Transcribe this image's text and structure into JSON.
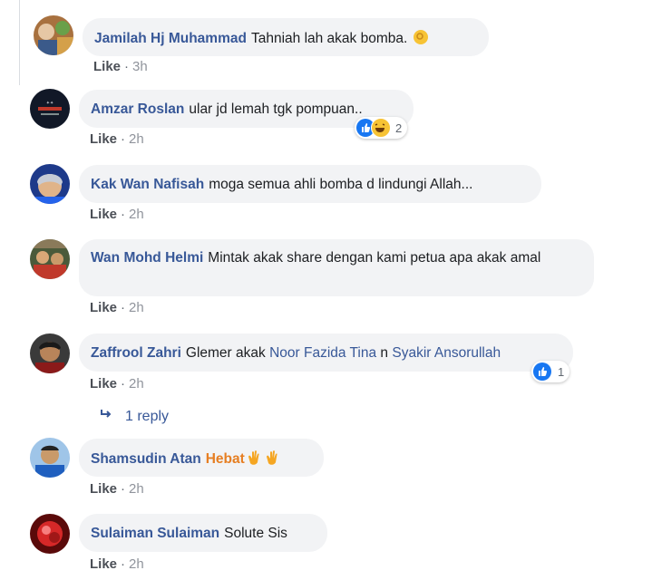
{
  "comments": [
    {
      "name": "Jamilah Hj Muhammad",
      "text": "Tahniah lah akak bomba.",
      "like": "Like",
      "time": "3h"
    },
    {
      "name": "Amzar Roslan",
      "text": "ular jd lemah tgk pompuan..",
      "like": "Like",
      "time": "2h",
      "reaction_count": "2"
    },
    {
      "name": "Kak Wan Nafisah",
      "text": "moga semua ahli bomba d lindungi Allah...",
      "like": "Like",
      "time": "2h"
    },
    {
      "name": "Wan Mohd Helmi",
      "text": "Mintak akak share dengan kami petua apa akak amal",
      "like": "Like",
      "time": "2h"
    },
    {
      "name": "Zaffrool Zahri",
      "text": "Glemer akak",
      "mention1": "Noor Fazida Tina",
      "conj": "n",
      "mention2": "Syakir Ansorullah",
      "like": "Like",
      "time": "2h",
      "reaction_count": "1"
    },
    {
      "name": "Shamsudin Atan",
      "text": "Hebat",
      "like": "Like",
      "time": "2h"
    },
    {
      "name": "Sulaiman Sulaiman",
      "text": "Solute Sis",
      "like": "Like",
      "time": "2h"
    }
  ],
  "reply_link": "1 reply",
  "colors": {
    "name": "#385898",
    "bubble": "#f2f3f5",
    "like_reaction": "#1877f2",
    "haha_reaction": "#f7c335"
  }
}
